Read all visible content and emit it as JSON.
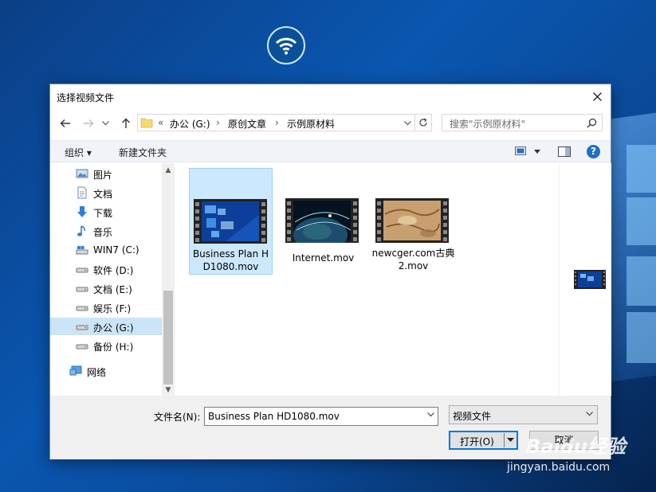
{
  "dialog": {
    "title": "选择视频文件"
  },
  "nav": {
    "back_icon": "arrow-left-icon",
    "forward_icon": "arrow-right-icon",
    "recent_icon": "chevron-down-icon",
    "up_icon": "arrow-up-icon"
  },
  "address": {
    "prefix": "«",
    "crumbs": [
      "办公 (G:)",
      "原创文章",
      "示例原材料"
    ],
    "separator": "›"
  },
  "search": {
    "placeholder": "搜索\"示例原材料\""
  },
  "toolbar": {
    "organize_label": "组织 ▾",
    "new_folder_label": "新建文件夹"
  },
  "sidebar": {
    "items": [
      {
        "label": "图片",
        "icon": "pictures-icon"
      },
      {
        "label": "文档",
        "icon": "documents-icon"
      },
      {
        "label": "下载",
        "icon": "download-icon"
      },
      {
        "label": "音乐",
        "icon": "music-icon"
      },
      {
        "label": "WIN7 (C:)",
        "icon": "system-drive-icon"
      },
      {
        "label": "软件 (D:)",
        "icon": "drive-icon"
      },
      {
        "label": "文档 (E:)",
        "icon": "drive-icon"
      },
      {
        "label": "娱乐 (F:)",
        "icon": "drive-icon"
      },
      {
        "label": "办公 (G:)",
        "icon": "drive-icon",
        "selected": true
      },
      {
        "label": "备份 (H:)",
        "icon": "drive-icon"
      },
      {
        "label": "网络",
        "icon": "network-icon"
      }
    ]
  },
  "files": [
    {
      "name": "Business Plan HD1080.mov",
      "selected": true,
      "thumb": "blue-grid-video-thumbnail"
    },
    {
      "name": "Internet.mov",
      "selected": false,
      "thumb": "globe-video-thumbnail"
    },
    {
      "name": "newcger.com古典2.mov",
      "selected": false,
      "thumb": "map-video-thumbnail"
    }
  ],
  "footer": {
    "filename_label": "文件名(N):",
    "filename_value": "Business Plan HD1080.mov",
    "filetype_value": "视频文件",
    "open_label": "打开(O)",
    "cancel_label": "取消"
  },
  "watermark": {
    "brand": "Baidu经验",
    "url": "jingyan.baidu.com"
  },
  "colors": {
    "accent": "#0078d7",
    "selection": "#cce8ff",
    "desktop": "#0a56b0"
  }
}
